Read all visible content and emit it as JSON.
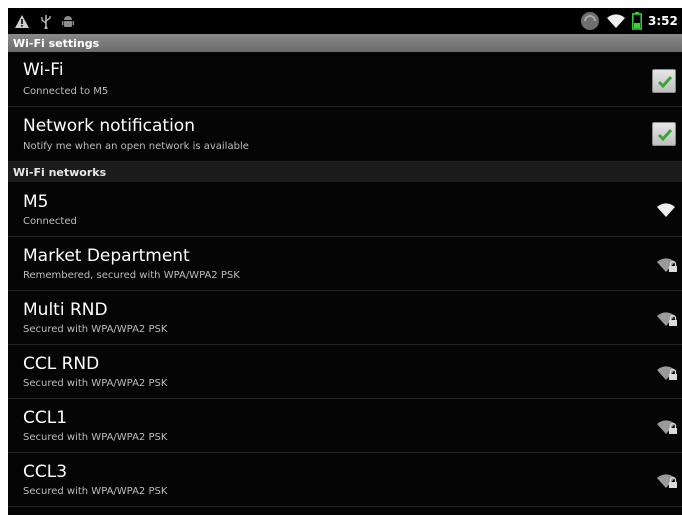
{
  "status_bar": {
    "time": "3:52 pm",
    "icons_left": [
      "warning-icon",
      "usb-icon",
      "android-icon"
    ],
    "icons_right": [
      "sync-icon",
      "wifi-icon",
      "battery-icon"
    ]
  },
  "settings_header": "Wi-Fi settings",
  "wifi": {
    "title": "Wi-Fi",
    "summary": "Connected to M5",
    "checked": true
  },
  "notification": {
    "title": "Network notification",
    "summary": "Notify me when an open network is available",
    "checked": true
  },
  "networks_header": "Wi-Fi networks",
  "networks": [
    {
      "ssid": "M5",
      "status": "Connected",
      "secured": false
    },
    {
      "ssid": "Market Department",
      "status": "Remembered, secured with WPA/WPA2 PSK",
      "secured": true
    },
    {
      "ssid": "Multi RND",
      "status": "Secured with WPA/WPA2 PSK",
      "secured": true
    },
    {
      "ssid": "CCL RND",
      "status": "Secured with WPA/WPA2 PSK",
      "secured": true
    },
    {
      "ssid": "CCL1",
      "status": "Secured with WPA/WPA2 PSK",
      "secured": true
    },
    {
      "ssid": "CCL3",
      "status": "Secured with WPA/WPA2 PSK",
      "secured": true
    }
  ],
  "colors": {
    "background": "#050505",
    "checkmark": "#3aa63a",
    "summary_text": "#bdbdbd"
  }
}
